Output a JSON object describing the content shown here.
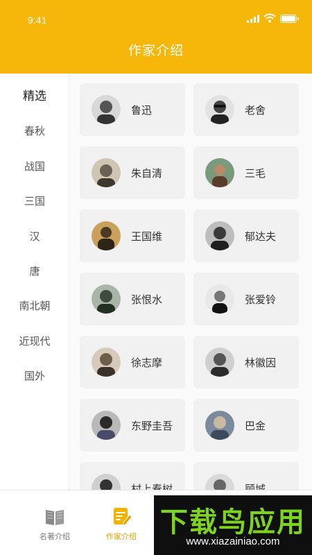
{
  "status_bar": {
    "time": "9:41"
  },
  "header": {
    "title": "作家介绍"
  },
  "sidebar": {
    "items": [
      {
        "label": "精选",
        "active": true
      },
      {
        "label": "春秋"
      },
      {
        "label": "战国"
      },
      {
        "label": "三国"
      },
      {
        "label": "汉"
      },
      {
        "label": "唐"
      },
      {
        "label": "南北朝"
      },
      {
        "label": "近现代"
      },
      {
        "label": "国外"
      }
    ]
  },
  "authors": [
    {
      "name": "鲁迅"
    },
    {
      "name": "老舍"
    },
    {
      "name": "朱自清"
    },
    {
      "name": "三毛"
    },
    {
      "name": "王国维"
    },
    {
      "name": "郁达夫"
    },
    {
      "name": "张恨水"
    },
    {
      "name": "张爱铃"
    },
    {
      "name": "徐志摩"
    },
    {
      "name": "林徽因"
    },
    {
      "name": "东野圭吾"
    },
    {
      "name": "巴金"
    },
    {
      "name": "村上春树"
    },
    {
      "name": "顾城"
    }
  ],
  "tabbar": {
    "tabs": [
      {
        "label": "名著介绍",
        "icon": "book-icon"
      },
      {
        "label": "作家介绍",
        "icon": "pen-note-icon",
        "active": true
      }
    ]
  },
  "watermark": {
    "title": "下载鸟应用",
    "url": "www.xiazainiao.com"
  },
  "colors": {
    "accent": "#f6b60a",
    "active_tab": "#e0a400",
    "watermark_green": "#7ed321"
  }
}
